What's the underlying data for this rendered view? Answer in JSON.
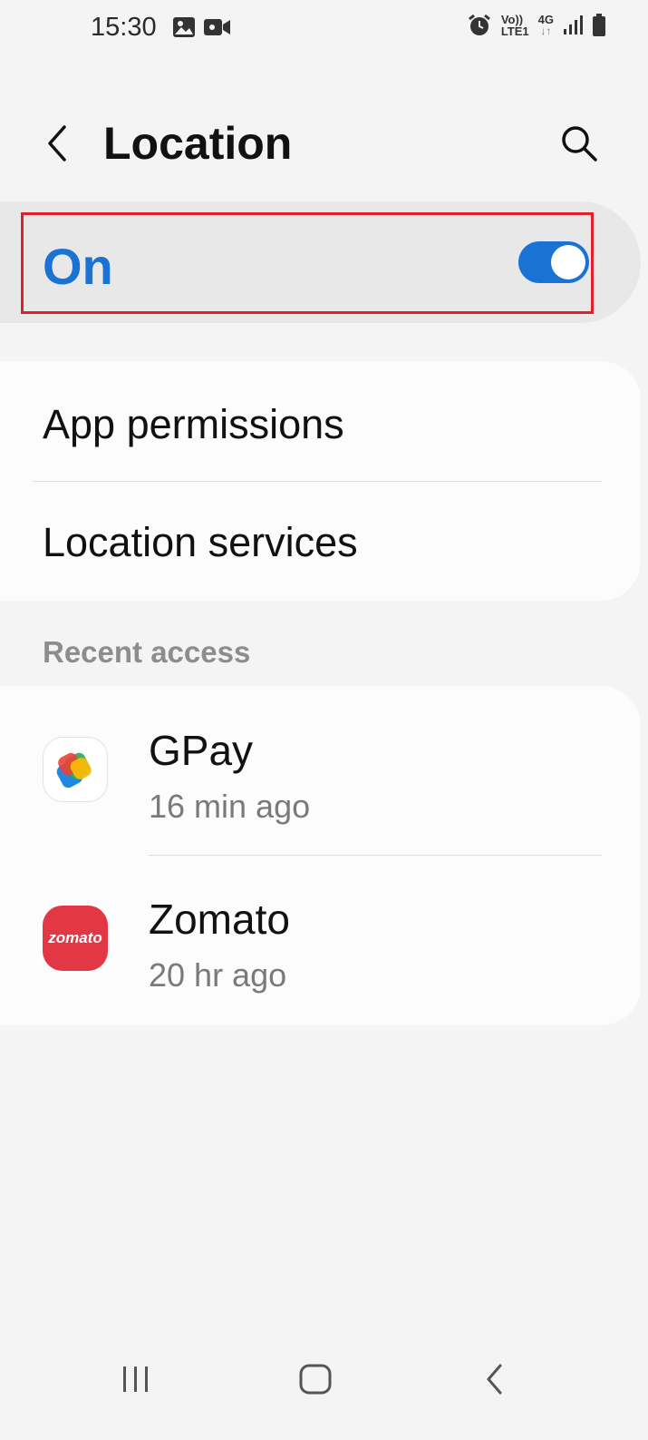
{
  "status_bar": {
    "time": "15:30",
    "icons_left": [
      "gallery-icon",
      "video-record-icon"
    ],
    "icons_right": [
      "alarm-icon",
      "volte-icon",
      "4g-icon",
      "signal-icon",
      "battery-icon"
    ],
    "volte_label_top": "Vo))",
    "volte_label_bottom": "LTE1",
    "network_label": "4G"
  },
  "header": {
    "title": "Location",
    "back_icon": "back-chevron-icon",
    "search_icon": "search-icon"
  },
  "location_toggle": {
    "label": "On",
    "state": true,
    "accent_color": "#1a73d4",
    "highlight_color": "#e0202a"
  },
  "settings": {
    "items": [
      {
        "label": "App permissions"
      },
      {
        "label": "Location services"
      }
    ]
  },
  "recent_access": {
    "header": "Recent access",
    "apps": [
      {
        "name": "GPay",
        "time": "16 min ago",
        "icon": "gpay-icon"
      },
      {
        "name": "Zomato",
        "time": "20 hr ago",
        "icon": "zomato-icon",
        "icon_text": "zomato",
        "icon_color": "#e23744"
      }
    ]
  },
  "nav_bar": {
    "buttons": [
      "recents-icon",
      "home-icon",
      "back-icon"
    ]
  }
}
